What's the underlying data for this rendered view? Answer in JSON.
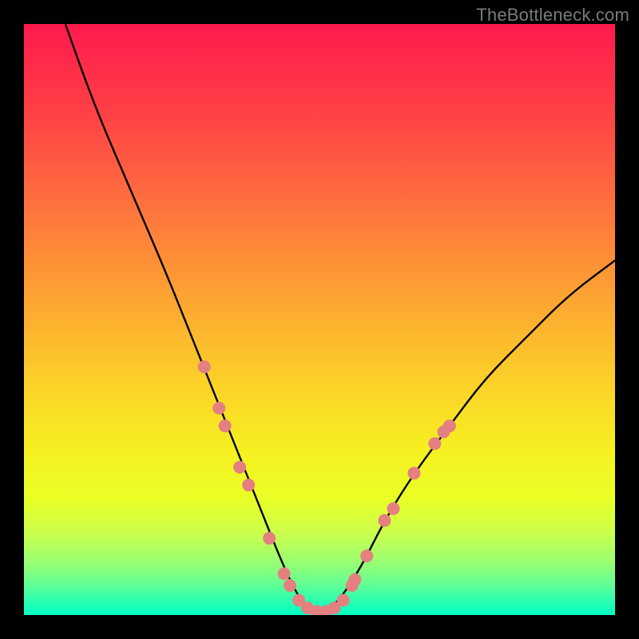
{
  "watermark": "TheBottleneck.com",
  "chart_data": {
    "type": "line",
    "title": "",
    "xlabel": "",
    "ylabel": "",
    "xlim": [
      0,
      100
    ],
    "ylim": [
      0,
      100
    ],
    "grid": false,
    "legend": false,
    "background_gradient_stops": [
      {
        "offset": 0.0,
        "color": "#ff1a4d"
      },
      {
        "offset": 0.14,
        "color": "#ff3e46"
      },
      {
        "offset": 0.3,
        "color": "#fe6f3e"
      },
      {
        "offset": 0.45,
        "color": "#fda033"
      },
      {
        "offset": 0.6,
        "color": "#fccf29"
      },
      {
        "offset": 0.72,
        "color": "#f6f021"
      },
      {
        "offset": 0.8,
        "color": "#eaff25"
      },
      {
        "offset": 0.86,
        "color": "#ccff4a"
      },
      {
        "offset": 0.91,
        "color": "#9aff72"
      },
      {
        "offset": 0.95,
        "color": "#5fff95"
      },
      {
        "offset": 0.975,
        "color": "#2effb1"
      },
      {
        "offset": 1.0,
        "color": "#00ffc3"
      }
    ],
    "series": [
      {
        "name": "bottleneck-curve",
        "color": "#000000",
        "x": [
          7,
          12,
          18,
          24,
          28,
          32,
          36,
          40,
          44,
          47,
          50,
          53,
          57,
          61,
          66,
          72,
          78,
          85,
          92,
          100
        ],
        "y": [
          100,
          86,
          72,
          58,
          48,
          38,
          28,
          18,
          8,
          2,
          0,
          2,
          8,
          16,
          24,
          32,
          40,
          47,
          54,
          60
        ]
      }
    ],
    "markers": {
      "name": "highlight-dots",
      "color": "#e48080",
      "radius": 8,
      "points": [
        {
          "x": 30.5,
          "y": 42
        },
        {
          "x": 33.0,
          "y": 35
        },
        {
          "x": 34.0,
          "y": 32
        },
        {
          "x": 36.5,
          "y": 25
        },
        {
          "x": 38.0,
          "y": 22
        },
        {
          "x": 41.5,
          "y": 13
        },
        {
          "x": 44.0,
          "y": 7
        },
        {
          "x": 45.0,
          "y": 5
        },
        {
          "x": 46.5,
          "y": 2.5
        },
        {
          "x": 48.0,
          "y": 1.2
        },
        {
          "x": 49.5,
          "y": 0.6
        },
        {
          "x": 51.0,
          "y": 0.6
        },
        {
          "x": 52.5,
          "y": 1.2
        },
        {
          "x": 54.0,
          "y": 2.5
        },
        {
          "x": 55.5,
          "y": 5
        },
        {
          "x": 56.0,
          "y": 6
        },
        {
          "x": 58.0,
          "y": 10
        },
        {
          "x": 61.0,
          "y": 16
        },
        {
          "x": 62.5,
          "y": 18
        },
        {
          "x": 66.0,
          "y": 24
        },
        {
          "x": 69.5,
          "y": 29
        },
        {
          "x": 71.0,
          "y": 31
        },
        {
          "x": 72.0,
          "y": 32
        }
      ]
    }
  }
}
